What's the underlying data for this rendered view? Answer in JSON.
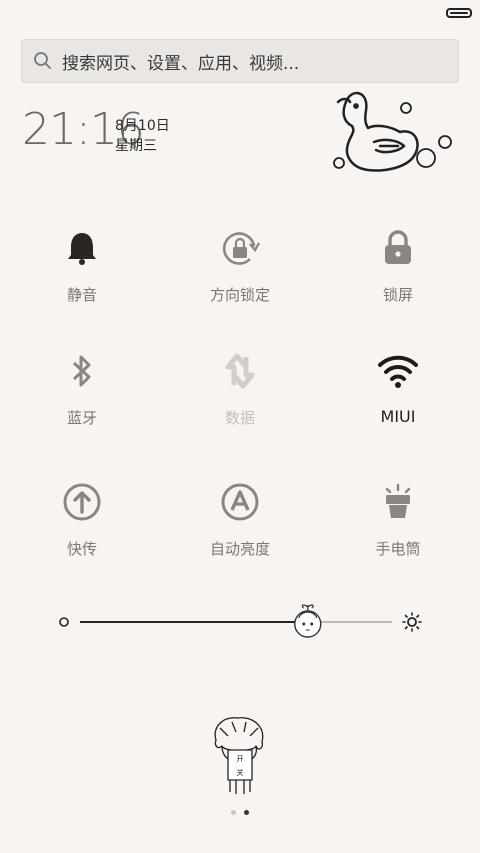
{
  "search": {
    "placeholder": "搜索网页、设置、应用、视频..."
  },
  "clock": {
    "time": "21:16",
    "date": "8月10日",
    "weekday": "星期三"
  },
  "toggles": [
    {
      "label": "静音",
      "icon": "bell-icon"
    },
    {
      "label": "方向锁定",
      "icon": "rotation-lock-icon"
    },
    {
      "label": "锁屏",
      "icon": "padlock-icon"
    },
    {
      "label": "蓝牙",
      "icon": "bluetooth-icon"
    },
    {
      "label": "数据",
      "icon": "mobile-data-icon"
    },
    {
      "label": "MIUI",
      "icon": "wifi-icon"
    },
    {
      "label": "快传",
      "icon": "quick-transfer-icon"
    },
    {
      "label": "自动亮度",
      "icon": "auto-brightness-icon"
    },
    {
      "label": "手电筒",
      "icon": "flashlight-icon"
    }
  ],
  "brightness": {
    "level": 0.73
  },
  "pager": {
    "total": 2,
    "active": 2
  },
  "colors": {
    "background": "#f7f4f1",
    "icon": "#8a8683",
    "dark": "#2a2623"
  }
}
